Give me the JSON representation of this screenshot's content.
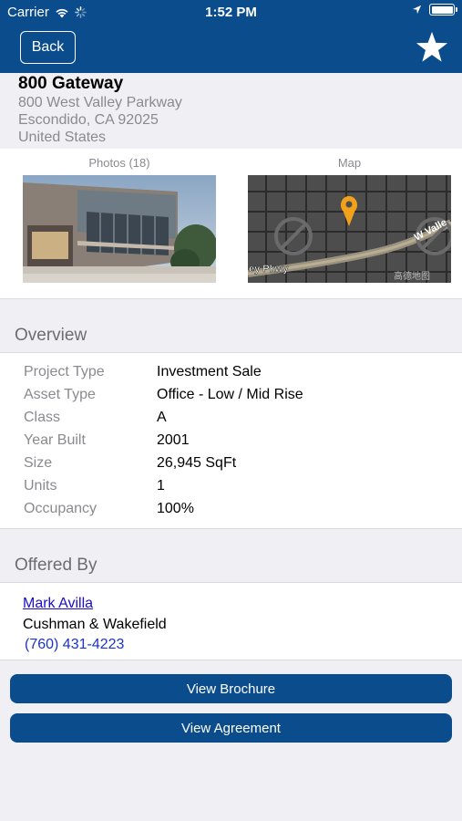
{
  "status_bar": {
    "carrier": "Carrier",
    "time": "1:52 PM"
  },
  "nav": {
    "back_label": "Back",
    "favorite_icon": "star-icon",
    "bar_color": "#0a4c8c"
  },
  "property": {
    "name": "800 Gateway",
    "address_line1": "800 West Valley Parkway",
    "address_line2": "Escondido, CA 92025",
    "address_line3": "United States"
  },
  "media": {
    "photos_label": "Photos (18)",
    "map_label": "Map",
    "map_street_left": "ey Pkwy",
    "map_street_right": "W Valle",
    "map_watermark": "高德地图"
  },
  "overview": {
    "title": "Overview",
    "rows": [
      {
        "label": "Project Type",
        "value": "Investment Sale"
      },
      {
        "label": "Asset Type",
        "value": "Office - Low / Mid Rise"
      },
      {
        "label": "Class",
        "value": "A"
      },
      {
        "label": "Year Built",
        "value": "2001"
      },
      {
        "label": "Size",
        "value": "26,945 SqFt"
      },
      {
        "label": "Units",
        "value": "1"
      },
      {
        "label": "Occupancy",
        "value": "100%"
      }
    ]
  },
  "offered_by": {
    "title": "Offered By",
    "contact_name": "Mark Avilla",
    "company": "Cushman & Wakefield",
    "phone": "(760) 431-4223"
  },
  "actions": {
    "brochure_label": "View Brochure",
    "agreement_label": "View Agreement"
  }
}
